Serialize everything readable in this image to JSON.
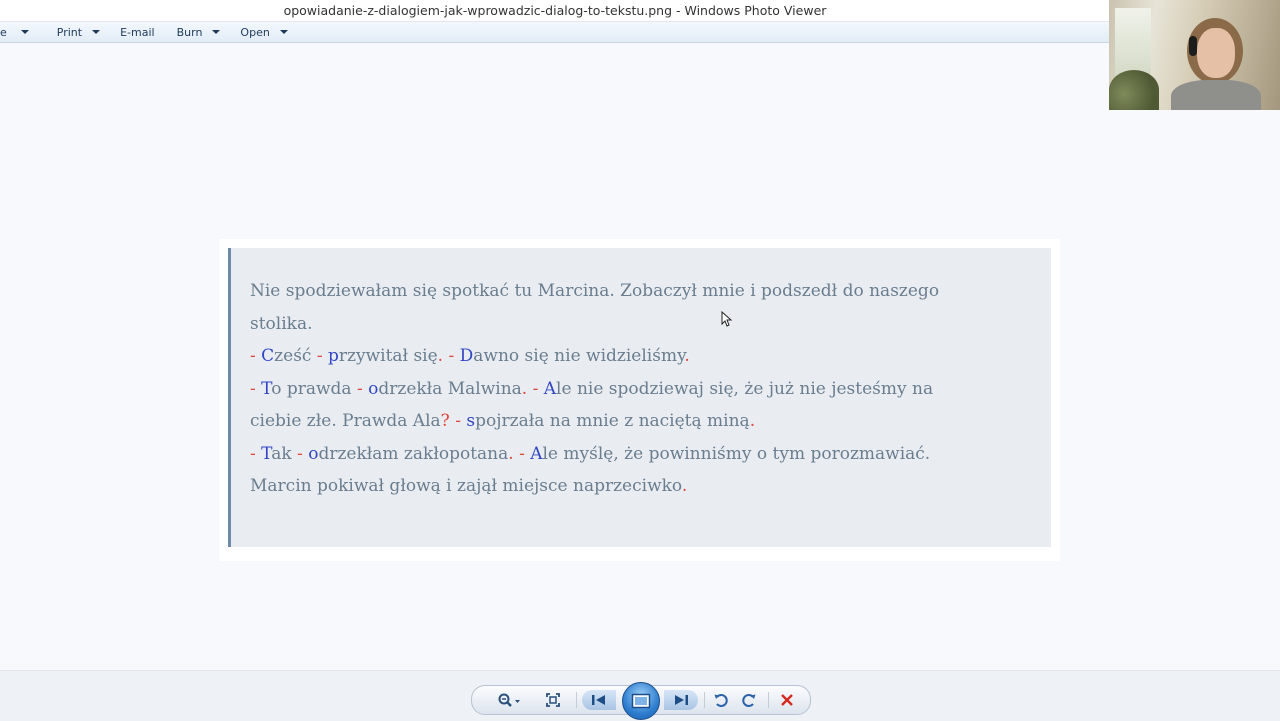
{
  "window": {
    "title": "opowiadanie-z-dialogiem-jak-wprowadzic-dialog-to-tekstu.png - Windows Photo Viewer"
  },
  "menu": [
    {
      "label": "e"
    },
    {
      "label": "Print"
    },
    {
      "label": "E-mail"
    },
    {
      "label": "Burn"
    },
    {
      "label": "Open"
    }
  ],
  "image_text": {
    "line1": "Nie spodziewałam się spotkać tu Marcina. Zobaczył mnie i podszedł do naszego",
    "line2": "stolika.",
    "line3": {
      "d1": "- ",
      "c1": "C",
      "t1": "ześć ",
      "d2": "- ",
      "c2": "p",
      "t2": "rzywitał się",
      "p1": ". ",
      "d3": "- ",
      "c3": "D",
      "t3": "awno się nie widzieliśmy",
      "p2": "."
    },
    "line4": {
      "d1": "- ",
      "c1": "T",
      "t1": "o prawda ",
      "d2": "- ",
      "c2": "o",
      "t2": "drzekła Malwina",
      "p1": ". ",
      "d3": "- ",
      "c3": "A",
      "t3": "le nie spodziewaj się, że już nie jesteśmy na"
    },
    "line5": {
      "t1": "ciebie złe. Prawda Ala",
      "p1": "?",
      "s1": " ",
      "d1": "- ",
      "c1": "s",
      "t2": "pojrzała na mnie z naciętą miną",
      "p2": "."
    },
    "line6": {
      "d1": "- ",
      "c1": "T",
      "t1": "ak ",
      "d2": "- ",
      "c2": "o",
      "t2": "drzekłam zakłopotana",
      "p1": ". ",
      "d3": "- ",
      "c3": "A",
      "t3": "le myślę, że powinniśmy o tym porozmawiać."
    },
    "line7": {
      "t1": "Marcin pokiwał głową i zajął miejsce naprzeciwko",
      "p1": "."
    }
  },
  "colors": {
    "dash": "#e0443a",
    "capital": "#3146c5",
    "body_text": "#6a7d8e",
    "quote_border": "#6c8aa6"
  },
  "controls": [
    {
      "icon": "zoom-icon"
    },
    {
      "icon": "actual-size-icon"
    },
    {
      "icon": "previous-icon"
    },
    {
      "icon": "slideshow-icon"
    },
    {
      "icon": "next-icon"
    },
    {
      "icon": "rotate-counterclockwise-icon"
    },
    {
      "icon": "rotate-clockwise-icon"
    },
    {
      "icon": "delete-icon"
    }
  ]
}
